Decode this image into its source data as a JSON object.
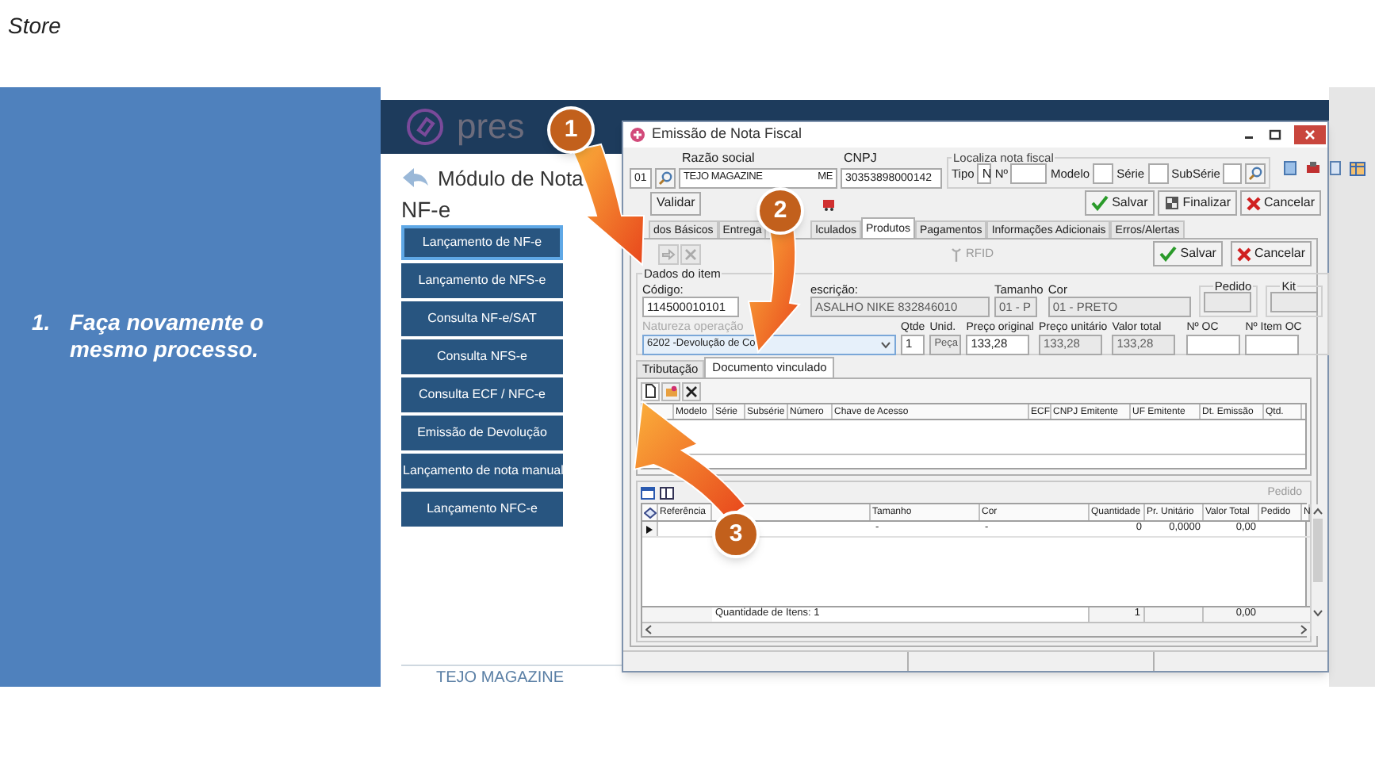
{
  "slide": {
    "title": "Store",
    "step": {
      "number": "1.",
      "text": "Faça novamente o mesmo processo."
    }
  },
  "app": {
    "logo_text": "pres",
    "module_title": "Módulo de Nota",
    "section_title": "NF-e",
    "menu": [
      {
        "label": "Lançamento de NF-e",
        "selected": true
      },
      {
        "label": "Lançamento de NFS-e",
        "selected": false
      },
      {
        "label": "Consulta NF-e/SAT",
        "selected": false
      },
      {
        "label": "Consulta NFS-e",
        "selected": false
      },
      {
        "label": "Consulta ECF / NFC-e",
        "selected": false
      },
      {
        "label": "Emissão de Devolução",
        "selected": false
      },
      {
        "label": "Lançamento de nota manual",
        "selected": false
      },
      {
        "label": "Lançamento NFC-e",
        "selected": false
      }
    ],
    "footer": "TEJO MAGAZINE"
  },
  "dialog": {
    "title": "Emissão de Nota Fiscal",
    "company": {
      "code": "01",
      "name_label": "Razão social",
      "name_parts": [
        "TEJO MAGAZINE",
        "ME"
      ],
      "cnpj_label": "CNPJ",
      "cnpj": "30353898000142"
    },
    "locate": {
      "title": "Localiza nota fiscal",
      "fields": [
        {
          "label": "Tipo",
          "value": "N"
        },
        {
          "label": "Nº"
        },
        {
          "label": "Modelo"
        },
        {
          "label": "Série"
        },
        {
          "label": "SubSérie"
        }
      ]
    },
    "validate_button": "Validar",
    "actions": [
      {
        "label": "Salvar",
        "kind": "save"
      },
      {
        "label": "Finalizar",
        "kind": "finish"
      },
      {
        "label": "Cancelar",
        "kind": "cancel"
      }
    ],
    "tabs": [
      {
        "label": "dos Básicos",
        "selected": false
      },
      {
        "label": "Entrega",
        "selected": false
      },
      {
        "label": "lculados",
        "selected": false
      },
      {
        "label": "Produtos",
        "selected": true
      },
      {
        "label": "Pagamentos",
        "selected": false
      },
      {
        "label": "Informações Adicionais",
        "selected": false
      },
      {
        "label": "Erros/Alertas",
        "selected": false
      }
    ],
    "product": {
      "rfid": "RFID",
      "actions": [
        {
          "label": "Salvar",
          "kind": "save"
        },
        {
          "label": "Cancelar",
          "kind": "cancel"
        }
      ],
      "item_title": "Dados do item",
      "row_1": [
        {
          "label": "Código:",
          "value": "114500010101",
          "disabled": false
        },
        {
          "label": "escrição:",
          "value": "ASALHO  NIKE 832846010",
          "disabled": true
        },
        {
          "label": "Tamanho",
          "value": "01 - P",
          "disabled": true
        },
        {
          "label": "Cor",
          "value": "01 - PRETO",
          "disabled": true
        }
      ],
      "groups": [
        {
          "label": "Pedido"
        },
        {
          "label": "Kit"
        }
      ],
      "operation": {
        "label": "Natureza operação",
        "value": "6202 -Devolução de Co"
      },
      "row_2": [
        {
          "label": "Qtde",
          "value": "1",
          "disabled": false
        },
        {
          "label": "Unid.",
          "value": "Peça",
          "disabled": true
        },
        {
          "label": "Preço original",
          "value": "133,28",
          "disabled": false
        },
        {
          "label": "Preço unitário",
          "value": "133,28",
          "disabled": true
        },
        {
          "label": "Valor total",
          "value": "133,28",
          "disabled": true
        },
        {
          "label": "Nº OC",
          "disabled": false
        },
        {
          "label": "Nº Item OC",
          "disabled": false
        }
      ],
      "subtabs": [
        {
          "label": "Tributação",
          "selected": false
        },
        {
          "label": "Documento vinculado",
          "selected": true
        }
      ],
      "linked_columns": [
        "Modelo",
        "Série",
        "Subsérie",
        "Número",
        "Chave de Acesso",
        "ECF",
        "CNPJ Emitente",
        "UF Emitente",
        "Dt. Emissão",
        "Qtd."
      ],
      "items": {
        "label": "Pedido",
        "columns": [
          "Referência",
          "Tamanho",
          "Cor",
          "Quantidade",
          "Pr. Unitário",
          "Valor Total",
          "Pedido",
          "N"
        ],
        "rows": [
          {
            "current": true,
            "tamanho": "-",
            "cor": "-",
            "quantidade": "0",
            "pr_unitario": "0,0000",
            "valor_total": "0,00"
          }
        ],
        "summary": {
          "count": "Quantidade de Itens: 1",
          "quantidade": "1",
          "valor_total": "0,00"
        }
      }
    }
  },
  "callouts": [
    {
      "number": "1"
    },
    {
      "number": "2"
    },
    {
      "number": "3"
    }
  ]
}
